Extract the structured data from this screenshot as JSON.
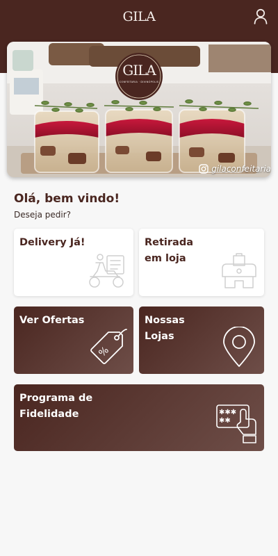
{
  "header": {
    "logo": "GILA",
    "user_icon": "user-icon"
  },
  "hero": {
    "badge_logo": "GILA",
    "badge_tagline": "CONFEITARIA · DIVINÓPOLIS",
    "instagram_handle": "gilaconfeitaria",
    "instagram_icon": "instagram-icon"
  },
  "greeting": {
    "title": "Olá, bem vindo!",
    "subtitle": "Deseja pedir?"
  },
  "cards": {
    "delivery": {
      "label": "Delivery Já!",
      "icon": "delivery-scooter-icon"
    },
    "pickup": {
      "label": "Retirada\nem loja",
      "icon": "store-pickup-icon"
    },
    "offers": {
      "label": "Ver Ofertas",
      "icon": "discount-tag-icon"
    },
    "stores": {
      "label": "Nossas\nLojas",
      "icon": "map-pin-icon"
    },
    "loyalty": {
      "label": "Programa de\nFidelidade",
      "icon": "loyalty-card-icon"
    }
  },
  "colors": {
    "brand": "#4a2620",
    "brand_light": "#6e4e48",
    "background": "#f7f7f7",
    "card_light": "#ffffff"
  }
}
